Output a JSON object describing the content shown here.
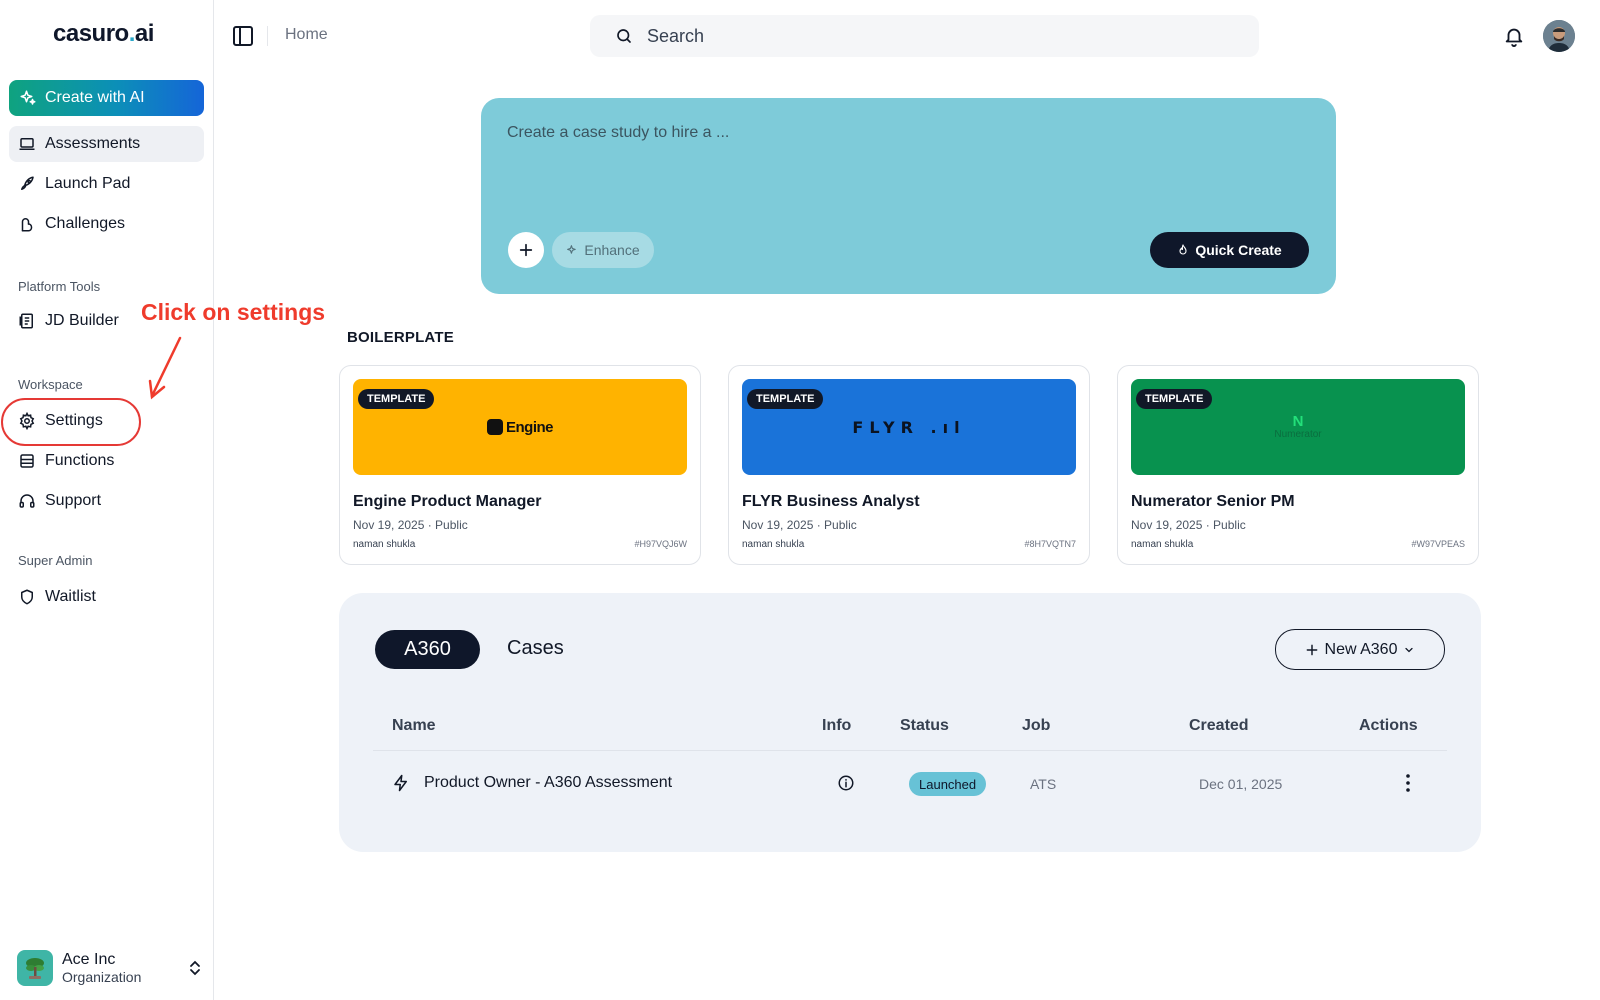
{
  "app": {
    "logo_main": "casuro",
    "logo_dot": ".",
    "logo_ai": "ai"
  },
  "sidebar": {
    "create_label": "Create with AI",
    "main_items": [
      {
        "label": "Assessments",
        "icon": "laptop-icon",
        "active": true
      },
      {
        "label": "Launch Pad",
        "icon": "rocket-icon"
      },
      {
        "label": "Challenges",
        "icon": "challenge-icon"
      }
    ],
    "section_platform": "Platform Tools",
    "platform_items": [
      {
        "label": "JD Builder",
        "icon": "jd-builder-icon"
      }
    ],
    "section_workspace": "Workspace",
    "workspace_items": [
      {
        "label": "Settings",
        "icon": "gear-icon"
      },
      {
        "label": "Functions",
        "icon": "functions-icon"
      },
      {
        "label": "Support",
        "icon": "headset-icon"
      }
    ],
    "section_super": "Super Admin",
    "super_items": [
      {
        "label": "Waitlist",
        "icon": "shield-icon"
      }
    ],
    "org": {
      "name": "Ace Inc",
      "type": "Organization"
    }
  },
  "annotation": {
    "text": "Click on settings",
    "color": "#ef3b2c"
  },
  "header": {
    "breadcrumb": "Home",
    "search_placeholder": "Search"
  },
  "prompt": {
    "placeholder": "Create a case study to hire a ...",
    "enhance_label": "Enhance",
    "quick_create_label": "Quick Create"
  },
  "boilerplate": {
    "label": "BOILERPLATE",
    "cards": [
      {
        "pill": "TEMPLATE",
        "brand": "Engine",
        "title": "Engine Product Manager",
        "meta": "Nov 19, 2025 · Public",
        "author": "naman shukla",
        "code": "#H97VQJ6W",
        "color": "#ffb300"
      },
      {
        "pill": "TEMPLATE",
        "brand": "FLYR",
        "title": "FLYR Business Analyst",
        "meta": "Nov 19, 2025 · Public",
        "author": "naman shukla",
        "code": "#8H7VQTN7",
        "color": "#1a73d9"
      },
      {
        "pill": "TEMPLATE",
        "brand": "Numerator",
        "title": "Numerator Senior PM",
        "meta": "Nov 19, 2025 · Public",
        "author": "naman shukla",
        "code": "#W97VPEAS",
        "color": "#08924f"
      }
    ]
  },
  "table": {
    "tab_active": "A360",
    "tab_other": "Cases",
    "new_button": "New A360",
    "columns": [
      "Name",
      "Info",
      "Status",
      "Job",
      "Created",
      "Actions"
    ],
    "rows": [
      {
        "name": "Product Owner - A360 Assessment",
        "status": "Launched",
        "job": "ATS",
        "created": "Dec 01, 2025"
      }
    ]
  }
}
